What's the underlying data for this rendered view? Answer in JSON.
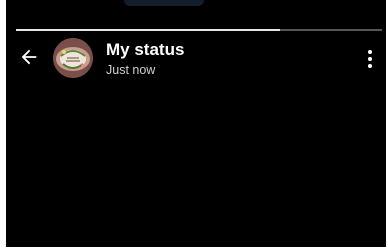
{
  "status_viewer": {
    "progress": 0.72,
    "header": {
      "back_icon": "arrow-left-icon",
      "title": "My status",
      "subtitle": "Just now",
      "menu_icon": "more-vertical-icon"
    },
    "avatar": {
      "description": "profile-photo",
      "colors": [
        "#8a5d58",
        "#f0e6dc",
        "#5a8c3a"
      ]
    }
  },
  "colors": {
    "background": "#000000",
    "progress_fill": "#e8e8e8",
    "progress_track": "#555555",
    "title_text": "#ffffff",
    "subtitle_text": "#d0d0d0"
  }
}
